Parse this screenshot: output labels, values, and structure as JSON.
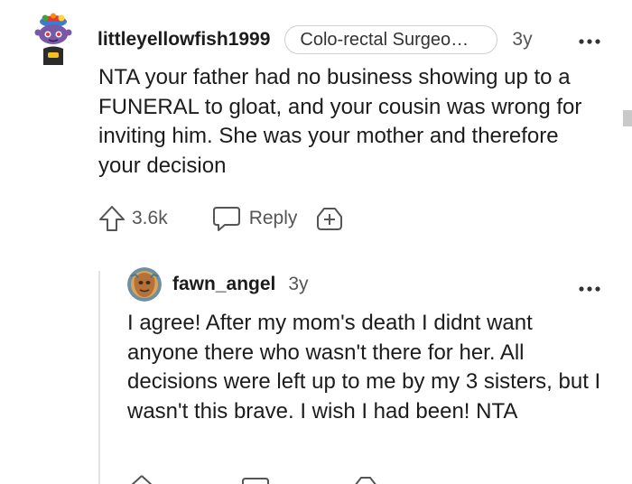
{
  "comment": {
    "username": "littleyellowfish1999",
    "flair": "Colo-rectal Surgeo…",
    "age": "3y",
    "more_icon": "ellipsis-icon",
    "body": "NTA your father had no business showing up to a FUNERAL to gloat, and your cousin was wrong for inviting him. She was your mother and therefore your decision",
    "upvotes": "3.6k",
    "reply_label": "Reply",
    "avatar_colors": {
      "body": "#7a58a8",
      "accent": "#f3c11b"
    }
  },
  "reply": {
    "username": "fawn_angel",
    "age": "3y",
    "more_icon": "ellipsis-icon",
    "body": "I agree! After my mom's death I didnt want anyone there who wasn't there for her. All decisions were left up to me by my 3 sisters, but I wasn't this brave. I wish I had been! NTA"
  },
  "colors": {
    "text": "#1c1c1c",
    "muted": "#555555",
    "border": "#d0d0d0",
    "thread_line": "#e4e4e4"
  }
}
